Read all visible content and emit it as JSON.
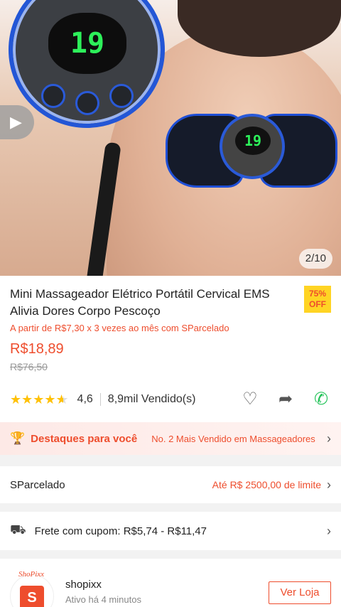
{
  "gallery": {
    "counter": "2/10",
    "device_display": "19",
    "play_icon": "play-icon"
  },
  "product": {
    "title": "Mini Massageador Elétrico Portátil Cervical EMS Alivia Dores Corpo Pescoço",
    "discount_percent": "75%",
    "discount_label": "OFF",
    "installment_text": "A partir de R$7,30 x 3 vezes ao mês com SParcelado",
    "price": "R$18,89",
    "original_price": "R$76,50",
    "rating_value": "4,6",
    "rating_stars": 4.6,
    "sold_text": "8,9mil Vendido(s)",
    "icons": [
      "heart-icon",
      "share-icon",
      "whatsapp-icon"
    ]
  },
  "highlights": {
    "label": "Destaques para você",
    "detail": "No. 2 Mais Vendido em Massageadores"
  },
  "sparcelado": {
    "label": "SParcelado",
    "limit_text": "Até R$ 2500,00 de limite"
  },
  "shipping": {
    "text": "Frete com cupom: R$5,74 - R$11,47"
  },
  "shop": {
    "brand": "ShoPixx",
    "name": "shopixx",
    "status": "Ativo há 4 minutos",
    "visit_label": "Ver Loja"
  },
  "colors": {
    "accent": "#ee4d2d",
    "star": "#ffc107",
    "discount_bg": "#ffd424"
  }
}
